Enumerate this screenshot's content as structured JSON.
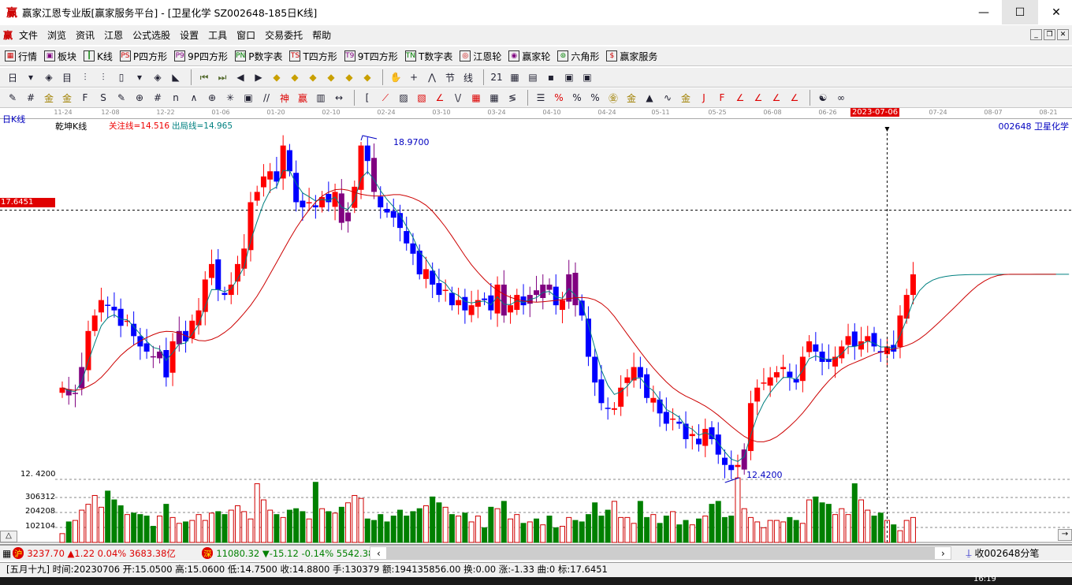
{
  "window": {
    "logo": "赢",
    "title": "赢家江恩专业版[赢家服务平台] - [卫星化学  SZ002648-185日K线]",
    "minimize": "—",
    "maximize": "☐",
    "close": "✕"
  },
  "menu": [
    "文件",
    "浏览",
    "资讯",
    "江恩",
    "公式选股",
    "设置",
    "工具",
    "窗口",
    "交易委托",
    "帮助"
  ],
  "toolbar1": [
    {
      "icon": "grid-icon",
      "glyph": "▦",
      "label": "行情"
    },
    {
      "icon": "blocks-icon",
      "glyph": "▣",
      "label": "板块"
    },
    {
      "icon": "kline-icon",
      "glyph": "┃",
      "label": "K线"
    },
    {
      "icon": "ps-icon",
      "glyph": "PS",
      "label": "P四方形"
    },
    {
      "icon": "p9-icon",
      "glyph": "P9",
      "label": "9P四方形"
    },
    {
      "icon": "pn-icon",
      "glyph": "PN",
      "label": "P数字表"
    },
    {
      "icon": "ts-icon",
      "glyph": "TS",
      "label": "T四方形"
    },
    {
      "icon": "t9-icon",
      "glyph": "T9",
      "label": "9T四方形"
    },
    {
      "icon": "tn-icon",
      "glyph": "TN",
      "label": "T数字表"
    },
    {
      "icon": "gann-wheel-icon",
      "glyph": "◎",
      "label": "江恩轮"
    },
    {
      "icon": "winner-wheel-icon",
      "glyph": "◉",
      "label": "赢家轮"
    },
    {
      "icon": "hexagon-icon",
      "glyph": "⊚",
      "label": "六角形"
    },
    {
      "icon": "dollar-icon",
      "glyph": "$",
      "label": "赢家服务"
    }
  ],
  "toolbar2": [
    "period-icon",
    "dropdown-icon",
    "cycle-icon",
    "list-icon",
    "bars3-icon",
    "bars9-icon",
    "candle-icon",
    "dropdown-icon",
    "gann-icon",
    "color-chart-icon",
    "sep",
    "first-icon",
    "last-icon",
    "prev-icon",
    "next-icon",
    "diamond-left-icon",
    "diamond-right-icon",
    "diamond-h-icon",
    "diamond-x-icon",
    "diamond-star-icon",
    "diamond-v-icon",
    "sep",
    "hand-icon",
    "crosshair-icon",
    "line-draw-icon",
    "festival-icon",
    "green-text-icon",
    "sep",
    "calendar-icon",
    "calculator-icon",
    "document-icon",
    "save-icon",
    "network-icon",
    "phone-icon"
  ],
  "toolbar3": [
    "pen-icon",
    "hash-icon",
    "gold1-icon",
    "gold2-icon",
    "f-icon",
    "spiral-icon",
    "brush-icon",
    "circle-grid-icon",
    "hash2-icon",
    "n2-icon",
    "fan-icon",
    "target-icon",
    "star-icon",
    "square-icon",
    "lines-icon",
    "god-icon",
    "win-icon",
    "ruler-icon",
    "width-icon",
    "sep",
    "bracket-icon",
    "fan-red-icon",
    "box-icon",
    "square-red-icon",
    "angle-icon",
    "zigzag-icon",
    "grid-red-icon",
    "grid2-icon",
    "slash-icon",
    "sep",
    "list2-icon",
    "percent-red-icon",
    "percent-icon",
    "percent-lines-icon",
    "gold-circle-icon",
    "gold-lines-icon",
    "chart-fan-icon",
    "wave-icon",
    "gold-box-icon",
    "j-angle-icon",
    "f-angle-icon",
    "gold-angle-icon",
    "angle2-icon",
    "angle3-icon",
    "angle4-icon",
    "sep",
    "yinyang-icon",
    "infinity-icon"
  ],
  "glyphs": {
    "pen-icon": "✎",
    "hash-icon": "#",
    "gold1-icon": "金",
    "gold2-icon": "金",
    "f-icon": "F",
    "spiral-icon": "S",
    "brush-icon": "✎",
    "circle-grid-icon": "⊕",
    "hash2-icon": "#",
    "n2-icon": "n",
    "fan-icon": "∧",
    "target-icon": "⊕",
    "star-icon": "✳",
    "square-icon": "▣",
    "lines-icon": "//",
    "god-icon": "神",
    "win-icon": "赢",
    "ruler-icon": "▥",
    "width-icon": "↔",
    "bracket-icon": "[",
    "fan-red-icon": "⟋",
    "box-icon": "▨",
    "square-red-icon": "▧",
    "angle-icon": "∠",
    "zigzag-icon": "\\/",
    "grid-red-icon": "▦",
    "grid2-icon": "▦",
    "slash-icon": "≶",
    "list2-icon": "☰",
    "percent-red-icon": "%",
    "percent-icon": "%",
    "percent-lines-icon": "%",
    "gold-circle-icon": "㊎",
    "gold-lines-icon": "金",
    "chart-fan-icon": "▲",
    "wave-icon": "∿",
    "gold-box-icon": "金",
    "j-angle-icon": "J",
    "f-angle-icon": "F",
    "gold-angle-icon": "∠",
    "angle2-icon": "∠",
    "angle3-icon": "∠",
    "angle4-icon": "∠",
    "yinyang-icon": "☯",
    "infinity-icon": "∞",
    "period-icon": "日",
    "dropdown-icon": "▾",
    "cycle-icon": "◈",
    "list-icon": "目",
    "bars3-icon": "⫶",
    "bars9-icon": "⫶",
    "candle-icon": "▯",
    "gann-icon": "◈",
    "color-chart-icon": "◣",
    "first-icon": "⏮",
    "last-icon": "⏭",
    "prev-icon": "◀",
    "next-icon": "▶",
    "diamond-left-icon": "◆",
    "diamond-right-icon": "◆",
    "diamond-h-icon": "◆",
    "diamond-x-icon": "◆",
    "diamond-star-icon": "◆",
    "diamond-v-icon": "◆",
    "hand-icon": "✋",
    "crosshair-icon": "+",
    "line-draw-icon": "⋀",
    "festival-icon": "节",
    "green-text-icon": "线",
    "calendar-icon": "21",
    "calculator-icon": "▦",
    "document-icon": "▤",
    "save-icon": "▪",
    "network-icon": "▣",
    "phone-icon": "▣"
  },
  "chart_header": {
    "period": "日K线",
    "indicator": "乾坤K线",
    "focus_line": "关注线=14.516",
    "exit_line": "出局线=14.965",
    "stock": "002648  卫星化学"
  },
  "chart_data": {
    "type": "candlestick",
    "x_ticks": [
      "11-24",
      "12-08",
      "12-22",
      "01-06",
      "01-20",
      "02-10",
      "02-24",
      "03-10",
      "03-24",
      "04-10",
      "04-24",
      "05-11",
      "05-25",
      "06-08",
      "06-26",
      "2023-07-06",
      "07-24",
      "08-07",
      "08-21"
    ],
    "highlighted_date": "2023-07-06",
    "cursor_price_label": "17.6451",
    "cursor_price": 17.6451,
    "cursor_index": 127,
    "high_label": "18.9700",
    "high_price": 18.97,
    "high_index": 46,
    "low_label": "12.4200",
    "low_price": 12.42,
    "low_index": 103,
    "y_bottom_label": "12. 4200",
    "closes": [
      14.2,
      14.05,
      14.1,
      14.6,
      15.3,
      15.6,
      15.9,
      15.8,
      15.7,
      15.4,
      15.5,
      15.2,
      15.0,
      14.9,
      14.8,
      14.9,
      14.4,
      15.1,
      15.3,
      15.1,
      15.5,
      15.7,
      16.3,
      16.6,
      16.1,
      16.0,
      16.2,
      16.6,
      16.9,
      17.8,
      18.0,
      18.3,
      18.4,
      18.2,
      18.9,
      18.4,
      17.8,
      17.7,
      17.8,
      17.7,
      17.9,
      17.8,
      18.0,
      17.4,
      17.6,
      18.1,
      18.9,
      18.6,
      18.0,
      17.7,
      17.6,
      17.5,
      17.3,
      17.0,
      16.8,
      16.4,
      16.5,
      16.2,
      16.0,
      16.1,
      15.8,
      15.9,
      15.7,
      15.8,
      15.9,
      15.9,
      15.7,
      16.2,
      15.6,
      15.8,
      16.0,
      15.8,
      16.0,
      16.0,
      16.2,
      16.1,
      15.8,
      15.9,
      16.4,
      15.8,
      15.6,
      14.8,
      14.3,
      13.9,
      13.8,
      13.8,
      14.2,
      14.4,
      14.6,
      14.4,
      14.0,
      14.0,
      13.7,
      13.5,
      13.6,
      13.5,
      13.2,
      13.3,
      13.1,
      13.4,
      13.2,
      12.9,
      12.7,
      12.6,
      12.7,
      13.0,
      13.9,
      14.2,
      14.3,
      14.4,
      14.5,
      14.6,
      14.4,
      14.3,
      14.8,
      15.1,
      14.9,
      14.7,
      14.7,
      14.8,
      15.0,
      15.2,
      15.0,
      15.1,
      15.2,
      15.0,
      14.88,
      15.0,
      14.9,
      15.6,
      16.0,
      16.4
    ],
    "purple_indices": [
      1,
      2,
      3,
      14,
      15,
      18,
      43,
      44,
      48,
      68,
      72,
      73,
      74,
      75,
      78,
      79,
      105
    ],
    "volume_ticks": [
      "306312",
      "204208",
      "102104"
    ],
    "volume_tick_values": [
      306312,
      204208,
      102104
    ],
    "volumes": [
      60000,
      140000,
      150000,
      220000,
      260000,
      320000,
      240000,
      350000,
      290000,
      250000,
      190000,
      200000,
      190000,
      180000,
      110000,
      180000,
      260000,
      170000,
      130000,
      140000,
      150000,
      190000,
      150000,
      200000,
      210000,
      190000,
      220000,
      250000,
      210000,
      160000,
      400000,
      290000,
      220000,
      190000,
      170000,
      220000,
      230000,
      210000,
      160000,
      410000,
      230000,
      210000,
      200000,
      240000,
      270000,
      320000,
      300000,
      160000,
      150000,
      190000,
      140000,
      180000,
      220000,
      180000,
      210000,
      230000,
      250000,
      310000,
      270000,
      240000,
      190000,
      180000,
      200000,
      140000,
      180000,
      100000,
      240000,
      230000,
      280000,
      160000,
      190000,
      130000,
      140000,
      160000,
      120000,
      180000,
      100000,
      110000,
      170000,
      150000,
      140000,
      190000,
      270000,
      180000,
      220000,
      280000,
      170000,
      170000,
      130000,
      280000,
      170000,
      190000,
      130000,
      180000,
      210000,
      120000,
      150000,
      120000,
      160000,
      180000,
      260000,
      280000,
      170000,
      180000,
      440000,
      230000,
      170000,
      140000,
      100000,
      150000,
      150000,
      140000,
      170000,
      150000,
      130000,
      290000,
      310000,
      270000,
      260000,
      190000,
      230000,
      190000,
      400000,
      290000,
      220000,
      180000,
      200000,
      150000,
      120000,
      80000,
      150000,
      170000
    ],
    "ma_short_color": "#008080",
    "ma_long_color": "#cc0000",
    "up_color": "#ff0000",
    "down_color": "#0000ff",
    "special_color": "#800080",
    "vol_up_color": "#d00000",
    "vol_down_color": "#008000"
  },
  "market_bar": {
    "sh_badge": "沪",
    "sh_text": "3237.70 ▲1.22 0.04% 3683.38亿",
    "sz_badge": "深",
    "sz_text": "11080.32 ▼-15.12 -0.14% 5542.38",
    "left_arrow": "‹",
    "right_arrow": "›",
    "feed": "收002648分笔"
  },
  "status": "[五月十九] 时间:20230706 开:15.0500 高:15.0600 低:14.7500 收:14.8800 手:130379 额:194135856.00 换:0.00 涨:-1.33 曲:0 标:17.6451",
  "clock": "16:19",
  "collapse_button": "△",
  "expand_button": "→"
}
